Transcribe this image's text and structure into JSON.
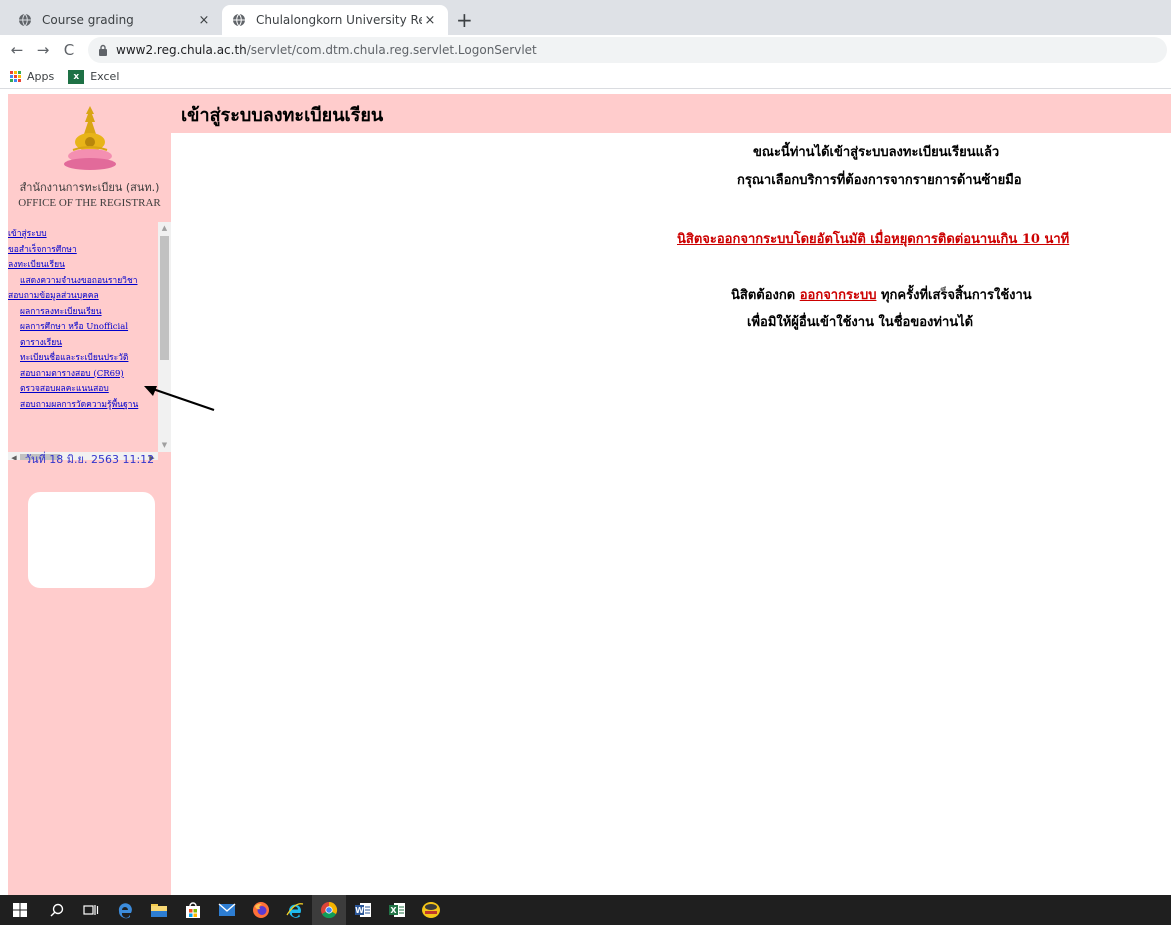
{
  "browser": {
    "tabs": [
      {
        "title": "Course grading",
        "active": false
      },
      {
        "title": "Chulalongkorn University Registr",
        "active": true
      }
    ],
    "new_tab": "+",
    "close_glyph": "×",
    "nav": {
      "back": "←",
      "forward": "→",
      "reload": "C"
    },
    "url": {
      "host": "www2.reg.chula.ac.th",
      "path": "/servlet/com.dtm.chula.reg.servlet.LogonServlet"
    },
    "bookmarks": [
      {
        "label": "Apps",
        "icon": "apps-grid-icon"
      },
      {
        "label": "Excel",
        "icon": "excel-icon"
      }
    ]
  },
  "page": {
    "header_title": "เข้าสู่ระบบลงทะเบียนเรียน",
    "office_th": "สำนักงานการทะเบียน (สนท.)",
    "office_en": "OFFICE OF THE REGISTRAR",
    "menu": [
      {
        "label": "เข้าสู่ระบบ",
        "sub": false
      },
      {
        "label": "ขอสำเร็จการศึกษา",
        "sub": false
      },
      {
        "label": "ลงทะเบียนเรียน",
        "sub": false
      },
      {
        "label": "แสดงความจำนงขอถอนรายวิชา",
        "sub": true
      },
      {
        "label": "สอบถามข้อมูลส่วนบุคคล",
        "sub": false
      },
      {
        "label": "ผลการลงทะเบียนเรียน",
        "sub": true
      },
      {
        "label": "ผลการศึกษา หรือ Unofficial",
        "sub": true
      },
      {
        "label": "ตารางเรียน",
        "sub": true
      },
      {
        "label": "ทะเบียนชื่อและระเบียนประวัติ",
        "sub": true
      },
      {
        "label": "สอบถามตารางสอบ (CR69)",
        "sub": true
      },
      {
        "label": "ตรวจสอบผลคะแนนสอบ",
        "sub": true
      },
      {
        "label": "สอบถามผลการวัดความรู้พื้นฐาน",
        "sub": true
      }
    ],
    "datetime": "วันที่ 18 มิ.ย. 2563 11:12",
    "message": {
      "line1": "ขณะนี้ท่านได้เข้าสู่ระบบลงทะเบียนเรียนแล้ว",
      "line2": "กรุณาเลือกบริการที่ต้องการจากรายการด้านซ้ายมือ",
      "warning": "นิสิตจะออกจากระบบโดยอัตโนมัติ เมื่อหยุดการติดต่อนานเกิน 10 นาที",
      "line3_pre": "นิสิตต้องกด ",
      "logout_link": "ออกจากระบบ",
      "line3_post": " ทุกครั้งที่เสร็จสิ้นการใช้งาน",
      "line4": "เพื่อมิให้ผู้อื่นเข้าใช้งาน ในชื่อของท่านได้"
    }
  },
  "taskbar": {
    "icons": [
      "windows-start-icon",
      "search-icon",
      "task-view-icon",
      "edge-icon",
      "file-explorer-icon",
      "store-icon",
      "mail-icon",
      "firefox-icon",
      "internet-explorer-icon",
      "chrome-icon",
      "word-icon",
      "excel-icon",
      "dtm-app-icon"
    ],
    "active": "chrome-icon"
  },
  "colors": {
    "page_bg": "#ffcccc",
    "link": "#0000cc",
    "warning": "#cc0000",
    "datetime": "#3333cc"
  }
}
